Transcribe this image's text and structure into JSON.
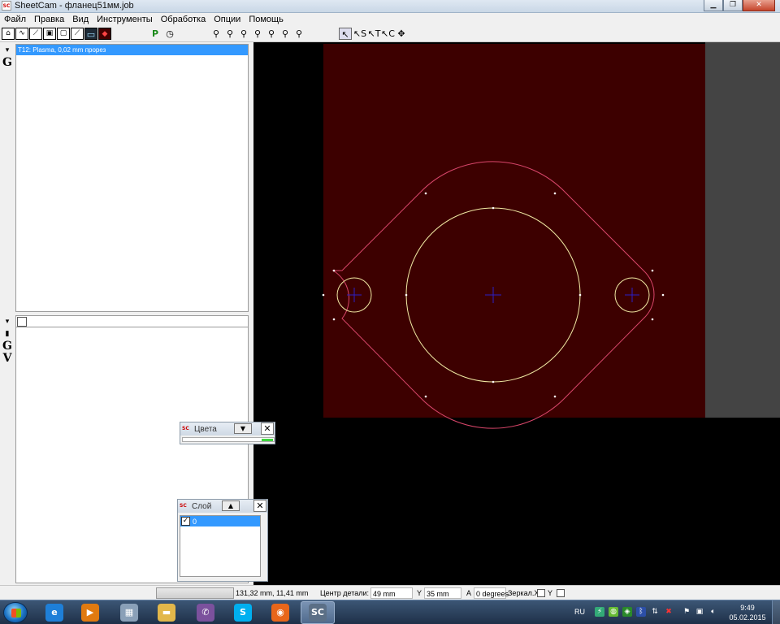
{
  "window": {
    "title": "SheetCam - фланец51мм.job",
    "app_icon": "SC"
  },
  "window_controls": {
    "minimize": "▁",
    "maximize": "❐",
    "close": "✕"
  },
  "menu": [
    "Файл",
    "Правка",
    "Вид",
    "Инструменты",
    "Обработка",
    "Опции",
    "Помощь"
  ],
  "toolbar": {
    "post_button": "P",
    "timer_icon": "◷",
    "zoom_tools": [
      "⚲",
      "⚲",
      "⚲",
      "⚲",
      "⚲",
      "⚲",
      "⚲"
    ],
    "select_tools": [
      "↖",
      "↖S",
      "↖T",
      "↖C",
      "✥"
    ]
  },
  "operations": {
    "items": [
      "T12: Plasma, 0,02 mm прорез"
    ]
  },
  "side_icons": {
    "top": [
      "▾",
      "G"
    ],
    "bottom": [
      "▾",
      "▮",
      "G",
      "V"
    ]
  },
  "colors_window": {
    "title": "Цвета",
    "dropdown_icon": "▼",
    "close": "✕"
  },
  "layer_window": {
    "title": "Слой",
    "collapse_icon": "▲",
    "close": "✕",
    "layers": [
      {
        "name": "0",
        "checked": true,
        "check_mark": "✓"
      }
    ]
  },
  "status_bar": {
    "coords": "131,32 mm, 11,41 mm",
    "center_label": "Центр детали: X",
    "center_x": "49 mm",
    "y_label": "Y",
    "center_y": "35 mm",
    "angle_label": "A",
    "angle_value": "0 degrees",
    "mirror_label": "Зеркал.X",
    "mirror_y_label": "Y"
  },
  "taskbar": {
    "language": "RU",
    "time": "9:49",
    "date": "05.02.2015",
    "apps": [
      {
        "name": "internet-explorer",
        "glyph": "e",
        "color": "#1e7fd8"
      },
      {
        "name": "media-player",
        "glyph": "▶",
        "color": "#e07a10"
      },
      {
        "name": "calculator",
        "glyph": "▦",
        "color": "#8aa0b8"
      },
      {
        "name": "file-explorer",
        "glyph": "▬",
        "color": "#e2b74a"
      },
      {
        "name": "viber",
        "glyph": "✆",
        "color": "#7b519d"
      },
      {
        "name": "skype",
        "glyph": "S",
        "color": "#00aff0"
      },
      {
        "name": "firefox",
        "glyph": "◉",
        "color": "#e8661a"
      },
      {
        "name": "sheetcam",
        "glyph": "SC",
        "color": "#5b6f86"
      }
    ]
  },
  "drawing": {
    "stock_color": "#3d0000",
    "outline_color": "#d9466a",
    "hole_color": "#f2eaa4",
    "center_mark_color": "#2a20c8"
  }
}
